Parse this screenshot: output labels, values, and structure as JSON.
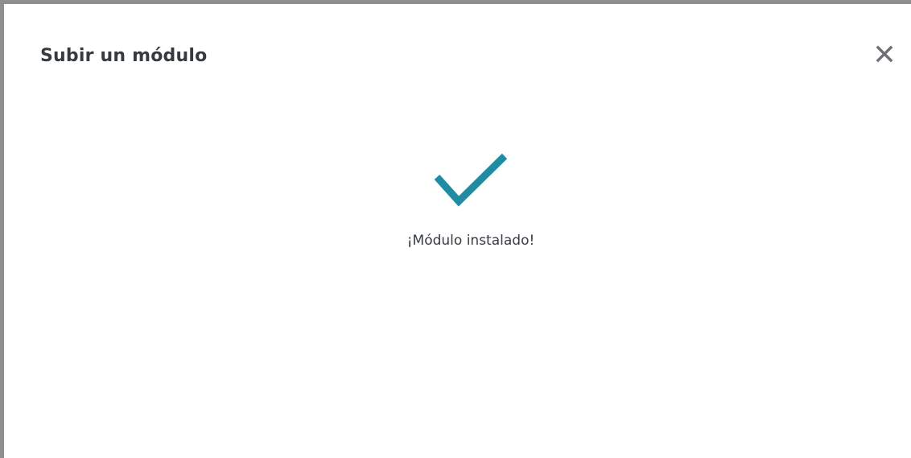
{
  "modal": {
    "title": "Subir un módulo",
    "close_icon": "close-icon",
    "status_icon": "checkmark-icon",
    "status_message": "¡Módulo instalado!",
    "accent_color": "#25b9d7",
    "check_color": "#1f8ca3",
    "text_color": "#363a41"
  }
}
